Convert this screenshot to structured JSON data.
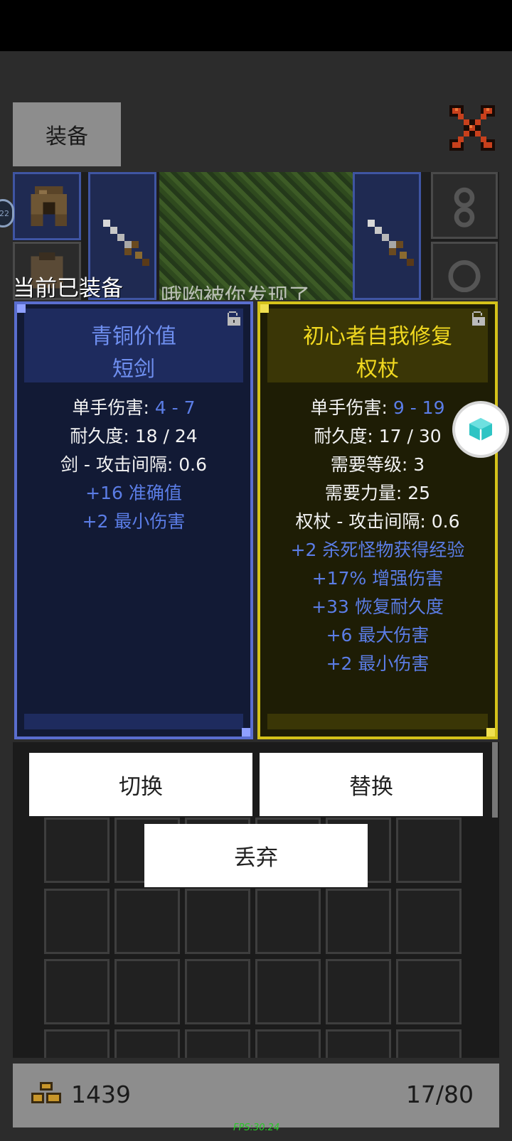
{
  "header": {
    "tab_equipment": "装备"
  },
  "scene": {
    "overlay_text": "哦哟被你发现了"
  },
  "equipped_label": "当前已装备",
  "side_badge": "22",
  "current_item": {
    "name_line1": "青铜价值",
    "name_line2": "短剑",
    "stats": [
      {
        "label": "单手伤害: ",
        "value": "4 - 7"
      },
      {
        "label": "耐久度: 18 / 24"
      },
      {
        "label": "剑 - 攻击间隔: 0.6"
      }
    ],
    "affixes": [
      "+16 准确值",
      "+2 最小伤害"
    ]
  },
  "compare_item": {
    "name_line1": "初心者自我修复",
    "name_line2": "权杖",
    "stats": [
      {
        "label": "单手伤害: ",
        "value": "9 - 19"
      },
      {
        "label": "耐久度: 17 / 30"
      },
      {
        "label": "需要等级: 3"
      },
      {
        "label": "需要力量: 25"
      },
      {
        "label": "权杖 - 攻击间隔: 0.6"
      }
    ],
    "affixes": [
      "+2 杀死怪物获得经验",
      "+17% 增强伤害",
      "+33 恢复耐久度",
      "+6 最大伤害",
      "+2 最小伤害"
    ]
  },
  "actions": {
    "switch": "切换",
    "replace": "替换",
    "discard": "丢弃"
  },
  "footer": {
    "gold": "1439",
    "capacity": "17/80"
  },
  "fps": "FPS:30.24",
  "colors": {
    "rare_blue": "#5a6ecf",
    "unique_gold": "#d4c21a",
    "affix_blue": "#5b7de6"
  },
  "icons": [
    "close-x-icon",
    "helmet-icon",
    "sword-icon",
    "lock-icon",
    "gold-coins-icon",
    "cube-icon"
  ]
}
